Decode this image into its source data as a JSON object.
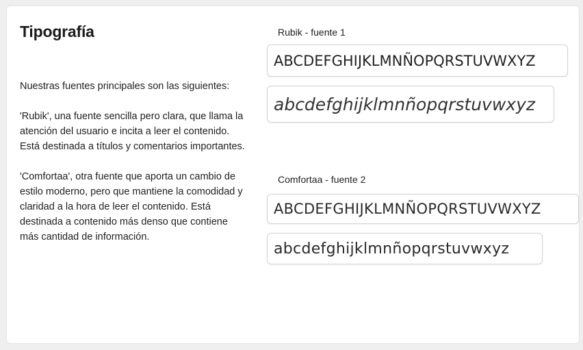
{
  "section": {
    "title": "Tipografía",
    "intro": "Nuestras fuentes principales son las siguientes:",
    "rubik_desc": "'Rubik', una fuente sencilla pero clara, que llama la atención del usuario e incita a leer el contenido. Está destinada a títulos y comentarios importantes.",
    "comfortaa_desc": "'Comfortaa', otra fuente que aporta un cambio de estilo moderno, pero que mantiene la comodidad y claridad a la hora de leer el contenido. Está destinada a contenido más denso que contiene más cantidad de información."
  },
  "fonts": {
    "primary": {
      "label": "Rubik - fuente 1",
      "uppercase": "ABCDEFGHIJKLMNÑOPQRSTUVWXYZ",
      "lowercase": "abcdefghijklmnñopqrstuvwxyz"
    },
    "secondary": {
      "label": "Comfortaa - fuente 2",
      "uppercase": "ABCDEFGHIJKLMNÑOPQRSTUVWXYZ",
      "lowercase": "abcdefghijklmnñopqrstuvwxyz"
    }
  },
  "colors": {
    "background": "#efefef",
    "card": "#ffffff",
    "text": "#1e1e1e",
    "border": "#d2d2d2"
  }
}
